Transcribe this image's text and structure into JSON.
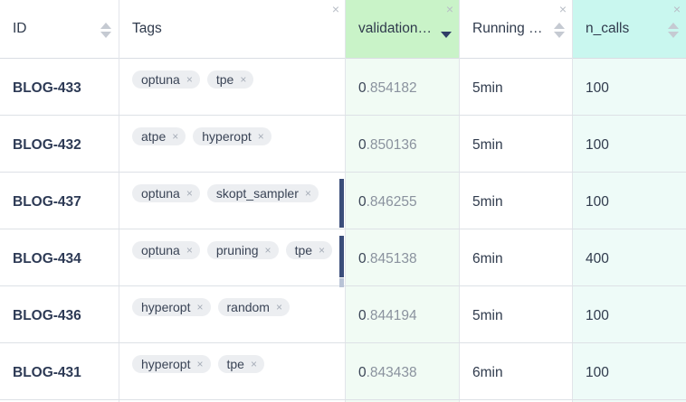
{
  "colors": {
    "validation_header_bg": "#c9f3c8",
    "validation_cell_bg": "#f1fbf4",
    "ncalls_header_bg": "#c9f7ef",
    "ncalls_cell_bg": "#eefbf8",
    "accent_dark": "#2f3d66"
  },
  "columns": {
    "id": {
      "label": "ID",
      "sort_icon": "sort-icon"
    },
    "tags": {
      "label": "Tags",
      "close_icon": "close-icon"
    },
    "validation": {
      "label": "validation…",
      "sort": "descending",
      "close_icon": "close-icon"
    },
    "running": {
      "label": "Running …",
      "close_icon": "close-icon"
    },
    "n_calls": {
      "label": "n_calls",
      "sort_icon": "sort-icon",
      "close_icon": "close-icon"
    }
  },
  "close_glyph": "×",
  "rows": [
    {
      "id": "BLOG-433",
      "tags": [
        "optuna",
        "tpe"
      ],
      "validation_lead": "0",
      "validation_rest": ".854182",
      "running": "5min",
      "n_calls": "100"
    },
    {
      "id": "BLOG-432",
      "tags": [
        "atpe",
        "hyperopt"
      ],
      "validation_lead": "0",
      "validation_rest": ".850136",
      "running": "5min",
      "n_calls": "100"
    },
    {
      "id": "BLOG-437",
      "tags": [
        "optuna",
        "skopt_sampler"
      ],
      "validation_lead": "0",
      "validation_rest": ".846255",
      "running": "5min",
      "n_calls": "100"
    },
    {
      "id": "BLOG-434",
      "tags": [
        "optuna",
        "pruning",
        "tpe"
      ],
      "validation_lead": "0",
      "validation_rest": ".845138",
      "running": "6min",
      "n_calls": "400"
    },
    {
      "id": "BLOG-436",
      "tags": [
        "hyperopt",
        "random"
      ],
      "validation_lead": "0",
      "validation_rest": ".844194",
      "running": "5min",
      "n_calls": "100"
    },
    {
      "id": "BLOG-431",
      "tags": [
        "hyperopt",
        "tpe"
      ],
      "validation_lead": "0",
      "validation_rest": ".843438",
      "running": "6min",
      "n_calls": "100"
    }
  ]
}
